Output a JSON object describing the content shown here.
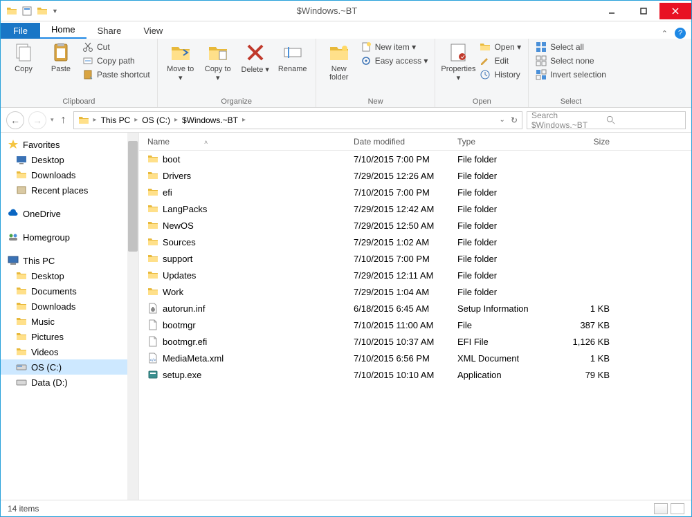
{
  "window": {
    "title": "$Windows.~BT",
    "minimize_tip": "Minimize",
    "maximize_tip": "Maximize",
    "close_tip": "Close"
  },
  "tabs": {
    "file": "File",
    "home": "Home",
    "share": "Share",
    "view": "View"
  },
  "ribbon": {
    "clipboard": {
      "copy": "Copy",
      "paste": "Paste",
      "cut": "Cut",
      "copy_path": "Copy path",
      "paste_shortcut": "Paste shortcut",
      "label": "Clipboard"
    },
    "organize": {
      "move_to": "Move to ▾",
      "copy_to": "Copy to ▾",
      "delete": "Delete ▾",
      "rename": "Rename",
      "label": "Organize"
    },
    "new": {
      "new_folder": "New folder",
      "new_item": "New item ▾",
      "easy_access": "Easy access ▾",
      "label": "New"
    },
    "open": {
      "properties": "Properties ▾",
      "open": "Open ▾",
      "edit": "Edit",
      "history": "History",
      "label": "Open"
    },
    "select": {
      "select_all": "Select all",
      "select_none": "Select none",
      "invert": "Invert selection",
      "label": "Select"
    }
  },
  "breadcrumb": {
    "items": [
      "This PC",
      "OS (C:)",
      "$Windows.~BT"
    ]
  },
  "search": {
    "placeholder": "Search $Windows.~BT"
  },
  "navpane": {
    "favorites": {
      "label": "Favorites",
      "items": [
        "Desktop",
        "Downloads",
        "Recent places"
      ]
    },
    "onedrive": "OneDrive",
    "homegroup": "Homegroup",
    "thispc": {
      "label": "This PC",
      "items": [
        "Desktop",
        "Documents",
        "Downloads",
        "Music",
        "Pictures",
        "Videos",
        "OS (C:)",
        "Data (D:)"
      ]
    }
  },
  "columns": {
    "name": "Name",
    "date": "Date modified",
    "type": "Type",
    "size": "Size"
  },
  "files": [
    {
      "icon": "folder",
      "name": "boot",
      "date": "7/10/2015 7:00 PM",
      "type": "File folder",
      "size": ""
    },
    {
      "icon": "folder",
      "name": "Drivers",
      "date": "7/29/2015 12:26 AM",
      "type": "File folder",
      "size": ""
    },
    {
      "icon": "folder",
      "name": "efi",
      "date": "7/10/2015 7:00 PM",
      "type": "File folder",
      "size": ""
    },
    {
      "icon": "folder",
      "name": "LangPacks",
      "date": "7/29/2015 12:42 AM",
      "type": "File folder",
      "size": ""
    },
    {
      "icon": "folder",
      "name": "NewOS",
      "date": "7/29/2015 12:50 AM",
      "type": "File folder",
      "size": ""
    },
    {
      "icon": "folder",
      "name": "Sources",
      "date": "7/29/2015 1:02 AM",
      "type": "File folder",
      "size": ""
    },
    {
      "icon": "folder",
      "name": "support",
      "date": "7/10/2015 7:00 PM",
      "type": "File folder",
      "size": ""
    },
    {
      "icon": "folder",
      "name": "Updates",
      "date": "7/29/2015 12:11 AM",
      "type": "File folder",
      "size": ""
    },
    {
      "icon": "folder",
      "name": "Work",
      "date": "7/29/2015 1:04 AM",
      "type": "File folder",
      "size": ""
    },
    {
      "icon": "inf",
      "name": "autorun.inf",
      "date": "6/18/2015 6:45 AM",
      "type": "Setup Information",
      "size": "1 KB"
    },
    {
      "icon": "file",
      "name": "bootmgr",
      "date": "7/10/2015 11:00 AM",
      "type": "File",
      "size": "387 KB"
    },
    {
      "icon": "file",
      "name": "bootmgr.efi",
      "date": "7/10/2015 10:37 AM",
      "type": "EFI File",
      "size": "1,126 KB"
    },
    {
      "icon": "xml",
      "name": "MediaMeta.xml",
      "date": "7/10/2015 6:56 PM",
      "type": "XML Document",
      "size": "1 KB"
    },
    {
      "icon": "exe",
      "name": "setup.exe",
      "date": "7/10/2015 10:10 AM",
      "type": "Application",
      "size": "79 KB"
    }
  ],
  "status": {
    "count": "14 items"
  }
}
